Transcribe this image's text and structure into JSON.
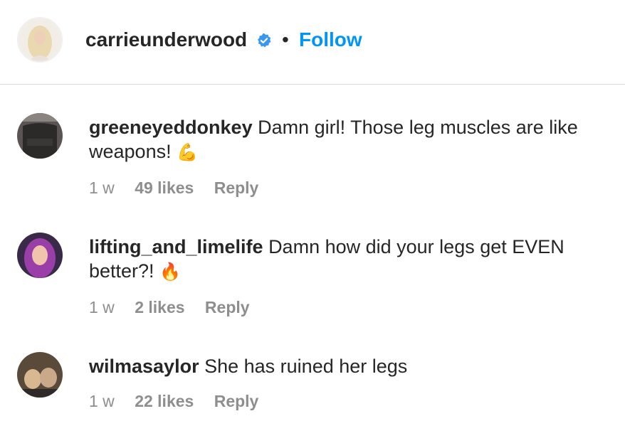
{
  "header": {
    "username": "carrieunderwood",
    "verified": true,
    "separator": "•",
    "follow_label": "Follow"
  },
  "comments": [
    {
      "username": "greeneyeddonkey",
      "text": "Damn girl! Those leg muscles are like weapons!",
      "emoji": "💪",
      "age": "1 w",
      "likes": "49 likes",
      "reply": "Reply"
    },
    {
      "username": "lifting_and_limelife",
      "text": "Damn how did your legs get EVEN better?!",
      "emoji": "🔥",
      "age": "1 w",
      "likes": "2 likes",
      "reply": "Reply"
    },
    {
      "username": "wilmasaylor",
      "text": "She has ruined her legs",
      "emoji": "",
      "age": "1 w",
      "likes": "22 likes",
      "reply": "Reply"
    }
  ],
  "colors": {
    "link_blue": "#0095f6",
    "verified_blue": "#3897f0",
    "meta_gray": "#8e8e8e",
    "divider": "#dbdbdb"
  }
}
